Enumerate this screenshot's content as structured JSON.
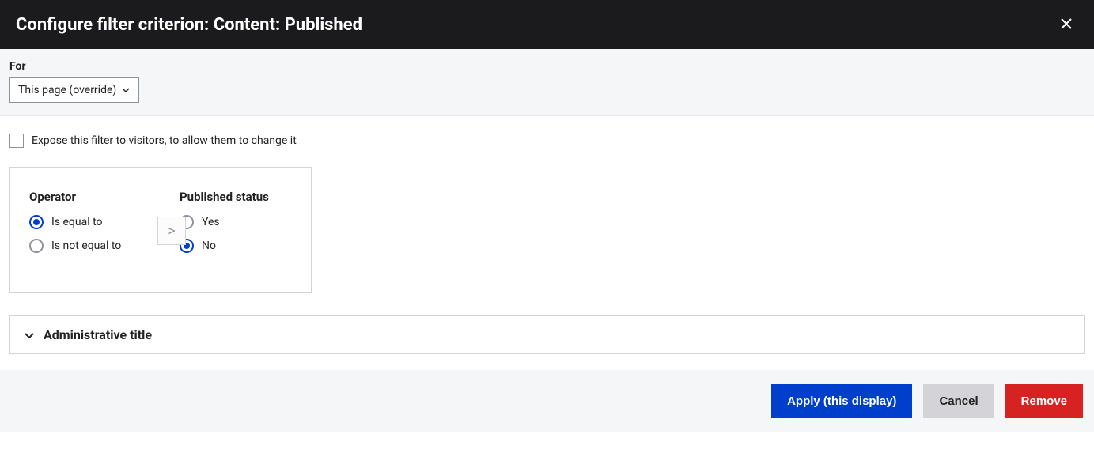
{
  "header": {
    "title": "Configure filter criterion: Content: Published"
  },
  "scope": {
    "label": "For",
    "selected": "This page (override)"
  },
  "expose": {
    "label": "Expose this filter to visitors, to allow them to change it",
    "checked": false
  },
  "operator": {
    "title": "Operator",
    "options": [
      {
        "label": "Is equal to",
        "checked": true
      },
      {
        "label": "Is not equal to",
        "checked": false
      }
    ]
  },
  "status": {
    "title": "Published status",
    "options": [
      {
        "label": "Yes",
        "checked": false
      },
      {
        "label": "No",
        "checked": true
      }
    ]
  },
  "arrow_glyph": ">",
  "collapsible": {
    "title": "Administrative title"
  },
  "footer": {
    "apply": "Apply (this display)",
    "cancel": "Cancel",
    "remove": "Remove"
  }
}
